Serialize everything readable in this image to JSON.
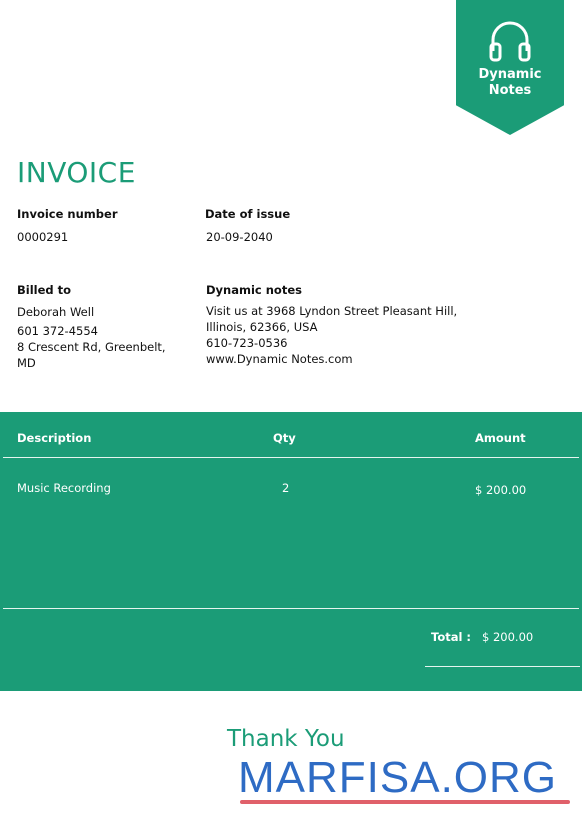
{
  "logo": {
    "line1": "Dynamic",
    "line2": "Notes",
    "icon": "headphones-icon"
  },
  "title": "INVOICE",
  "invoice_number": {
    "label": "Invoice number",
    "value": "0000291"
  },
  "date_of_issue": {
    "label": "Date of issue",
    "value": "20-09-2040"
  },
  "billed_to": {
    "label": "Billed to",
    "lines": [
      "Deborah Well",
      "601 372-4554",
      "8 Crescent Rd, Greenbelt,",
      "MD"
    ]
  },
  "company": {
    "label": "Dynamic notes",
    "lines": [
      "Visit us at 3968 Lyndon Street Pleasant Hill,",
      "Illinois, 62366, USA",
      "610-723-0536",
      "www.Dynamic Notes.com"
    ]
  },
  "table": {
    "headers": {
      "description": "Description",
      "qty": "Qty",
      "amount": "Amount"
    },
    "rows": [
      {
        "description": "Music Recording",
        "qty": "2",
        "amount": "$ 200.00"
      }
    ],
    "total_label": "Total :",
    "total_value": "$ 200.00"
  },
  "footer": {
    "thank_you": "Thank You",
    "watermark": "MARFISA.ORG"
  },
  "colors": {
    "accent": "#1b9c77",
    "watermark_blue": "#2e6bc4",
    "watermark_red": "#e0606a"
  }
}
